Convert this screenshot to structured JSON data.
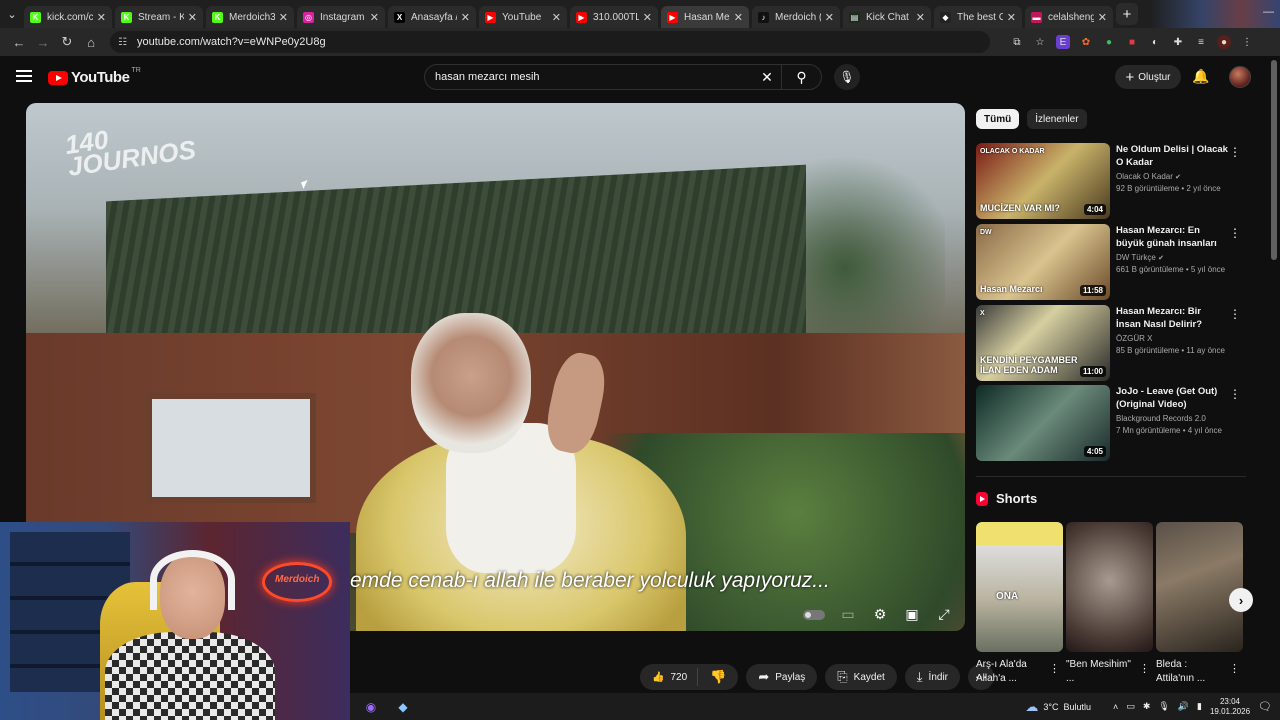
{
  "browser": {
    "tabs": [
      {
        "label": "kick.com/ca",
        "fav_color": "#53fc18",
        "fav_glyph": "K"
      },
      {
        "label": "Stream - Ki",
        "fav_color": "#53fc18",
        "fav_glyph": "K"
      },
      {
        "label": "Merdoich34",
        "fav_color": "#53fc18",
        "fav_glyph": "K"
      },
      {
        "label": "Instagram",
        "fav_color": "#d6249f",
        "fav_glyph": "◎"
      },
      {
        "label": "Anasayfa / X",
        "fav_color": "#000000",
        "fav_glyph": "X"
      },
      {
        "label": "YouTube",
        "fav_color": "#ff0000",
        "fav_glyph": "▶"
      },
      {
        "label": "310.000TL V",
        "fav_color": "#ff0000",
        "fav_glyph": "▶"
      },
      {
        "label": "Hasan Mezar",
        "fav_color": "#ff0000",
        "fav_glyph": "▶",
        "active": true
      },
      {
        "label": "Merdoich (@",
        "fav_color": "#111111",
        "fav_glyph": "♪"
      },
      {
        "label": "Kick Chat Se",
        "fav_color": "#1c2b1c",
        "fav_glyph": "▤"
      },
      {
        "label": "The best Ch",
        "fav_color": "#222222",
        "fav_glyph": "◆"
      },
      {
        "label": "celalshengn",
        "fav_color": "#c2185b",
        "fav_glyph": "▬"
      }
    ],
    "url": "youtube.com/watch?v=eWNPe0y2U8g"
  },
  "header": {
    "logo_text": "YouTube",
    "country_code": "TR",
    "search_value": "hasan mezarcı mesih",
    "create_label": "Oluştur"
  },
  "video": {
    "watermark": "140 JOURNOS",
    "subtitle": "emde cenab-ı allah ile beraber yolculuk yapıyoruz...",
    "webcam_neon": "Merdoich"
  },
  "actions": {
    "like_count": "720",
    "share_label": "Paylaş",
    "save_label": "Kaydet",
    "download_label": "İndir"
  },
  "sidebar": {
    "chips": [
      {
        "label": "Tümü",
        "active": true
      },
      {
        "label": "İzlenenler",
        "active": false
      }
    ],
    "recommendations": [
      {
        "title": "Ne Oldum Delisi | Olacak O Kadar",
        "channel": "Olacak O Kadar",
        "verified": true,
        "views": "92 B görüntüleme",
        "age": "2 yıl önce",
        "duration": "4:04",
        "thumb_text": "MUCİZEN VAR MI?",
        "thumb_badge": "OLACAK O KADAR",
        "thumb_bg": "linear-gradient(135deg,#7a1a14,#c9b36a 50%,#4a3a20)"
      },
      {
        "title": "Hasan Mezarcı: En büyük günah insanları asgari ...",
        "channel": "DW Türkçe",
        "verified": true,
        "views": "661 B görüntüleme",
        "age": "5 yıl önce",
        "duration": "11:58",
        "thumb_text": "Hasan Mezarcı",
        "thumb_badge": "DW",
        "thumb_bg": "linear-gradient(135deg,#8a6a48,#d9c38e 50%,#6a4a2a)"
      },
      {
        "title": "Hasan Mezarcı: Bir İnsan Nasıl Delirir?",
        "channel": "ÖZGÜR X",
        "verified": false,
        "views": "85 B görüntüleme",
        "age": "11 ay önce",
        "duration": "11:00",
        "thumb_text": "KENDİNİ PEYGAMBER İLAN EDEN ADAM",
        "thumb_badge": "X",
        "thumb_bg": "linear-gradient(135deg,#3a3a3a,#d6cfa0 40%,#2b2b2b)"
      },
      {
        "title": "JoJo - Leave (Get Out) (Original Video)",
        "channel": "Blackground Records 2.0",
        "verified": false,
        "views": "7 Mn görüntüleme",
        "age": "4 yıl önce",
        "duration": "4:05",
        "thumb_text": "",
        "thumb_badge": "",
        "thumb_bg": "linear-gradient(135deg,#0d2a24,#6a8a7a 50%,#1a2a2a)"
      }
    ],
    "shorts_title": "Shorts",
    "shorts": [
      {
        "label": "Arş-ı Ala'da Allah'a ...",
        "thumb_text": "ONA",
        "thumb_bg": "linear-gradient(180deg,#f0e070 0 18%,#ddd 18%,#b9b3a0 60%,#6a7060)"
      },
      {
        "label": "\"Ben Mesihim\" ...",
        "thumb_text": "",
        "thumb_bg": "radial-gradient(circle at 50% 45%,#a89a90,#4a3a34 70%,#201818)"
      },
      {
        "label": "Bleda : Attila'nın ...",
        "thumb_text": "",
        "thumb_bg": "linear-gradient(160deg,#5a5048,#8a7a66 40%,#2a241e)"
      }
    ]
  },
  "taskbar": {
    "temperature": "3°C",
    "weather": "Bulutlu",
    "time": "23:04",
    "date": "19.01.2026"
  }
}
